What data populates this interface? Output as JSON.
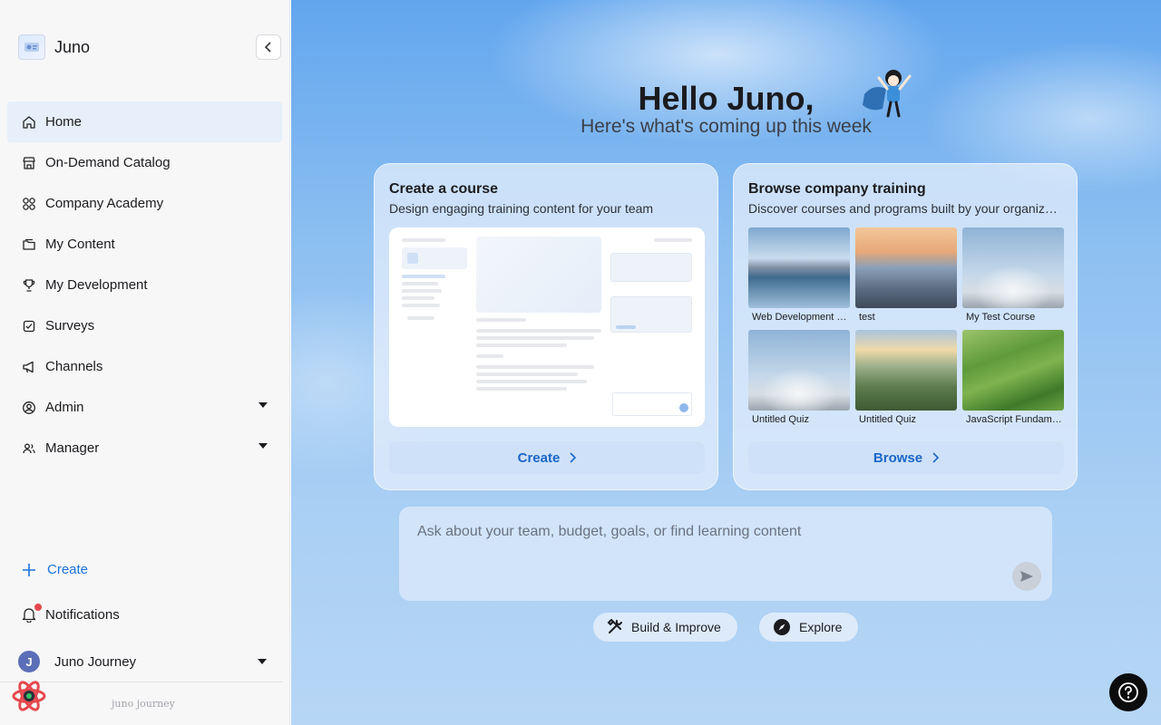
{
  "brand": {
    "name": "Juno",
    "logo_icon": "juno-logo-icon"
  },
  "sidebar": {
    "items": [
      {
        "label": "Home",
        "icon": "home-icon",
        "active": true
      },
      {
        "label": "On-Demand Catalog",
        "icon": "storefront-icon"
      },
      {
        "label": "Company Academy",
        "icon": "grid-circles-icon"
      },
      {
        "label": "My Content",
        "icon": "folder-icon"
      },
      {
        "label": "My Development",
        "icon": "trophy-icon"
      },
      {
        "label": "Surveys",
        "icon": "survey-icon"
      },
      {
        "label": "Channels",
        "icon": "megaphone-icon"
      },
      {
        "label": "Admin",
        "icon": "user-circle-icon",
        "expandable": true
      },
      {
        "label": "Manager",
        "icon": "users-icon",
        "expandable": true
      }
    ],
    "create_label": "Create",
    "notifications_label": "Notifications",
    "user": {
      "initial": "J",
      "name": "Juno Journey"
    },
    "footer_text": "juno journey"
  },
  "main": {
    "greeting": "Hello Juno,",
    "subtitle": "Here's what's coming up this week",
    "create_card": {
      "title": "Create a course",
      "subtitle": "Design engaging training content for your team",
      "button_label": "Create"
    },
    "browse_card": {
      "title": "Browse company training",
      "subtitle": "Discover courses and programs built by your organization",
      "button_label": "Browse",
      "courses": [
        {
          "label": "Web Development Bootcamp",
          "image": "mountain-lake"
        },
        {
          "label": "test",
          "image": "city-skyline"
        },
        {
          "label": "My Test Course",
          "image": "sky-rays"
        },
        {
          "label": "Untitled Quiz",
          "image": "sky-rays"
        },
        {
          "label": "Untitled Quiz",
          "image": "valley-sunrise"
        },
        {
          "label": "JavaScript Fundamentals",
          "image": "green-hills"
        }
      ]
    },
    "chat": {
      "placeholder": "Ask about your team, budget, goals, or find learning content",
      "send_icon": "send-icon"
    },
    "chips": [
      {
        "label": "Build & Improve",
        "icon": "tools-icon"
      },
      {
        "label": "Explore",
        "icon": "compass-icon"
      }
    ],
    "help_icon": "help-icon"
  }
}
